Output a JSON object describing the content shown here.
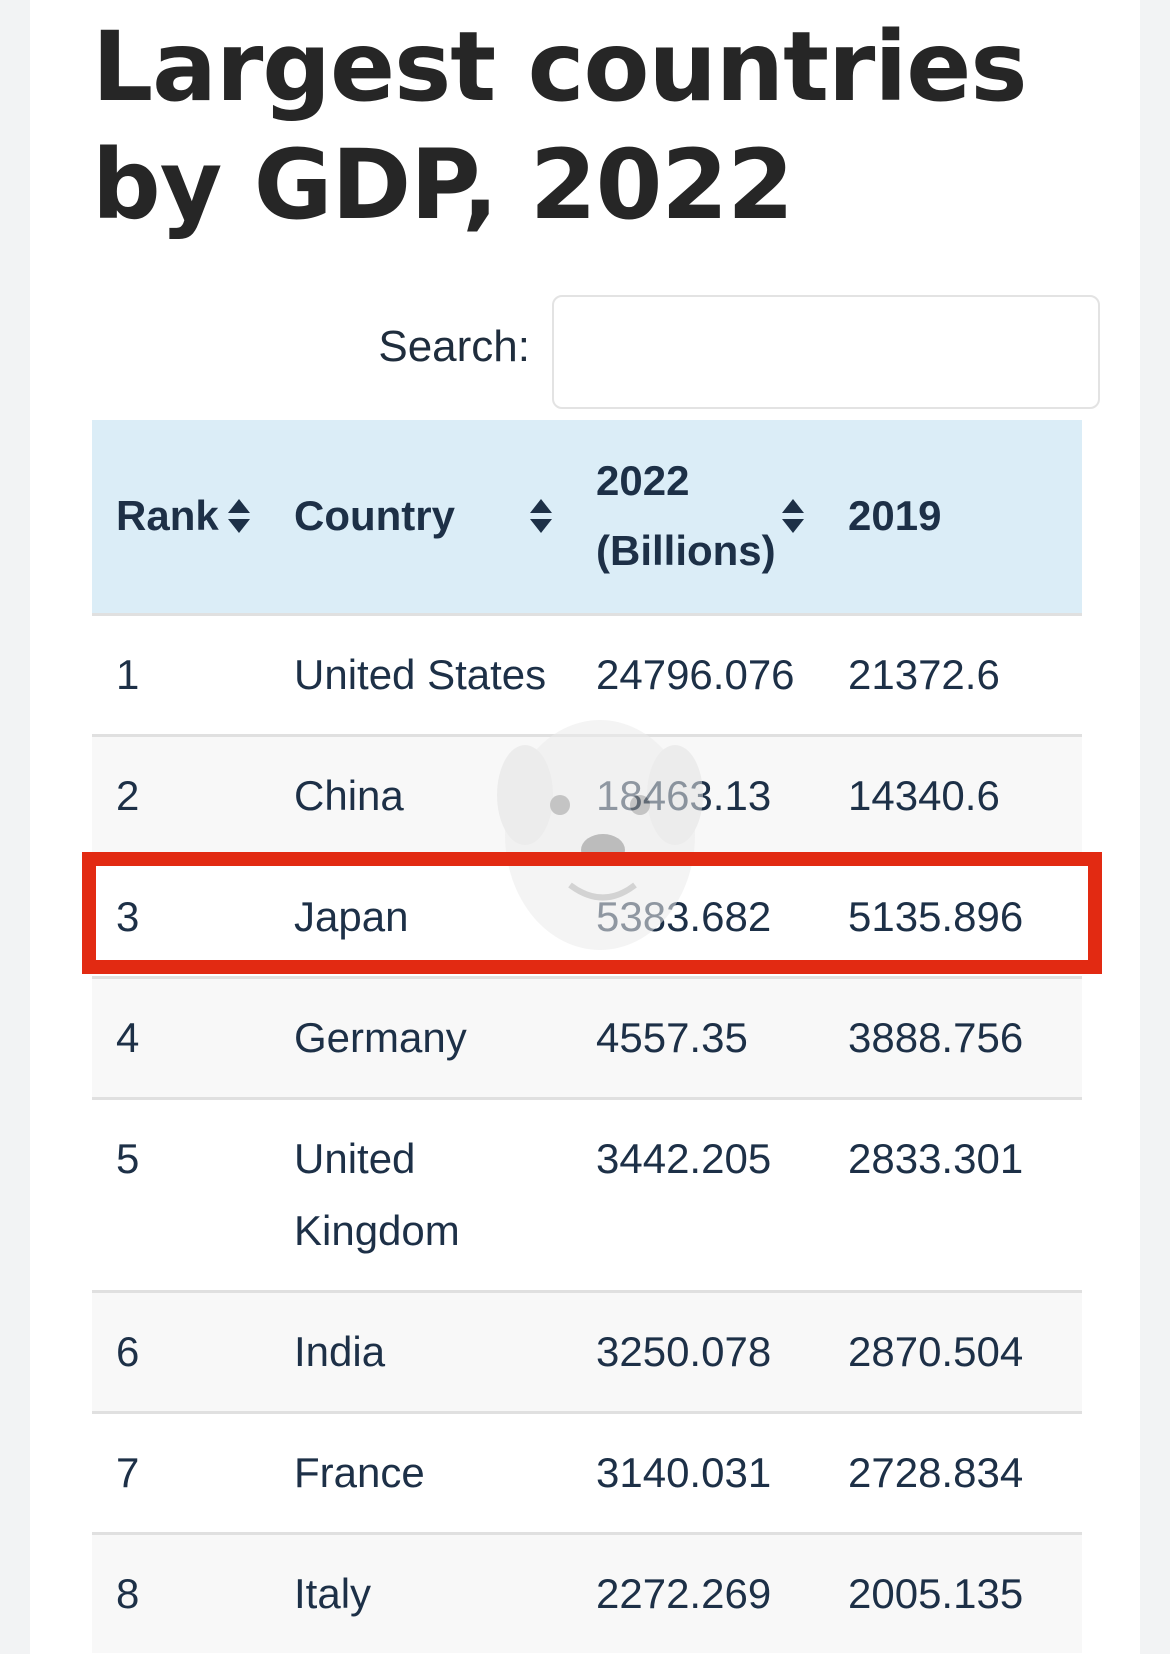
{
  "title": "Largest countries by GDP, 2022",
  "search": {
    "label": "Search:",
    "value": ""
  },
  "table": {
    "columns": [
      "Rank",
      "Country",
      "2022 (Billions)",
      "2019"
    ],
    "rows": [
      {
        "rank": "1",
        "country": "United States",
        "gdp_2022": "24796.076",
        "gdp_2019": "21372.6"
      },
      {
        "rank": "2",
        "country": "China",
        "gdp_2022": "18463.13",
        "gdp_2019": "14340.6"
      },
      {
        "rank": "3",
        "country": "Japan",
        "gdp_2022": "5383.682",
        "gdp_2019": "5135.896",
        "highlighted": true
      },
      {
        "rank": "4",
        "country": "Germany",
        "gdp_2022": "4557.35",
        "gdp_2019": "3888.756"
      },
      {
        "rank": "5",
        "country": "United Kingdom",
        "gdp_2022": "3442.205",
        "gdp_2019": "2833.301"
      },
      {
        "rank": "6",
        "country": "India",
        "gdp_2022": "3250.078",
        "gdp_2019": "2870.504"
      },
      {
        "rank": "7",
        "country": "France",
        "gdp_2022": "3140.031",
        "gdp_2019": "2728.834"
      },
      {
        "rank": "8",
        "country": "Italy",
        "gdp_2022": "2272.269",
        "gdp_2019": "2005.135"
      }
    ]
  },
  "colors": {
    "highlight_border": "#e22a12",
    "header_background": "#dbedf7",
    "text": "#1d3047"
  },
  "icons": {
    "sort": "sort-icon",
    "watermark": "dog-face-icon"
  }
}
